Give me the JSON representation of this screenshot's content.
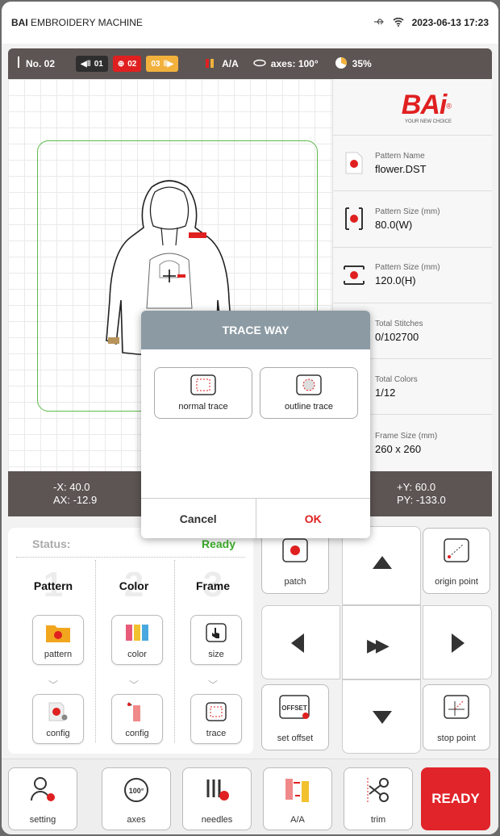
{
  "status_bar": {
    "brand_bold": "BAI",
    "brand_rest": " EMBROIDERY MACHINE",
    "datetime": "2023-06-13 17:23"
  },
  "top_bar": {
    "machine_no": "No. 02",
    "needle_prev": "01",
    "needle_current": "02",
    "needle_next": "03",
    "aa": "A/A",
    "axes": "axes: 100°",
    "progress": "35%"
  },
  "logo": {
    "text": "BAi",
    "tagline": "YOUR NEW CHOICE",
    "reg": "®"
  },
  "info": [
    {
      "label": "Pattern Name",
      "value": "flower.DST"
    },
    {
      "label": "Pattern Size (mm)",
      "value": "80.0(W)"
    },
    {
      "label": "Pattern Size (mm)",
      "value": "120.0(H)"
    },
    {
      "label": "Total Stitches",
      "value": "0/102700"
    },
    {
      "label": "Total Colors",
      "value": "1/12"
    },
    {
      "label": "Frame Size (mm)",
      "value": "260 x 260"
    }
  ],
  "coords": {
    "x": "-X: 40.0",
    "ax": "AX: -12.9",
    "y": "+Y: 60.0",
    "py": "PY: -133.0"
  },
  "status": {
    "label": "Status:",
    "value": "Ready"
  },
  "steps": [
    {
      "num": "1",
      "title": "Pattern"
    },
    {
      "num": "2",
      "title": "Color"
    },
    {
      "num": "3",
      "title": "Frame"
    }
  ],
  "step_buttons": {
    "pattern": "pattern",
    "color": "color",
    "size": "size",
    "config1": "config",
    "config2": "config",
    "trace": "trace"
  },
  "controls": {
    "patch": "patch",
    "origin_point": "origin point",
    "set_offset": "set offset",
    "offset_badge": "OFFSET",
    "stop_point": "stop point"
  },
  "bottom": {
    "setting": "setting",
    "axes": "axes",
    "axes_badge": "100°",
    "needles": "needles",
    "aa": "A/A",
    "trim": "trim",
    "ready": "READY"
  },
  "modal": {
    "title": "TRACE WAY",
    "normal": "normal trace",
    "outline": "outline trace",
    "cancel": "Cancel",
    "ok": "OK"
  },
  "colors": {
    "accent": "#e02020",
    "ready_green": "#3dae2b",
    "bar": "#5d5553",
    "modal_header": "#8c9aa3"
  }
}
